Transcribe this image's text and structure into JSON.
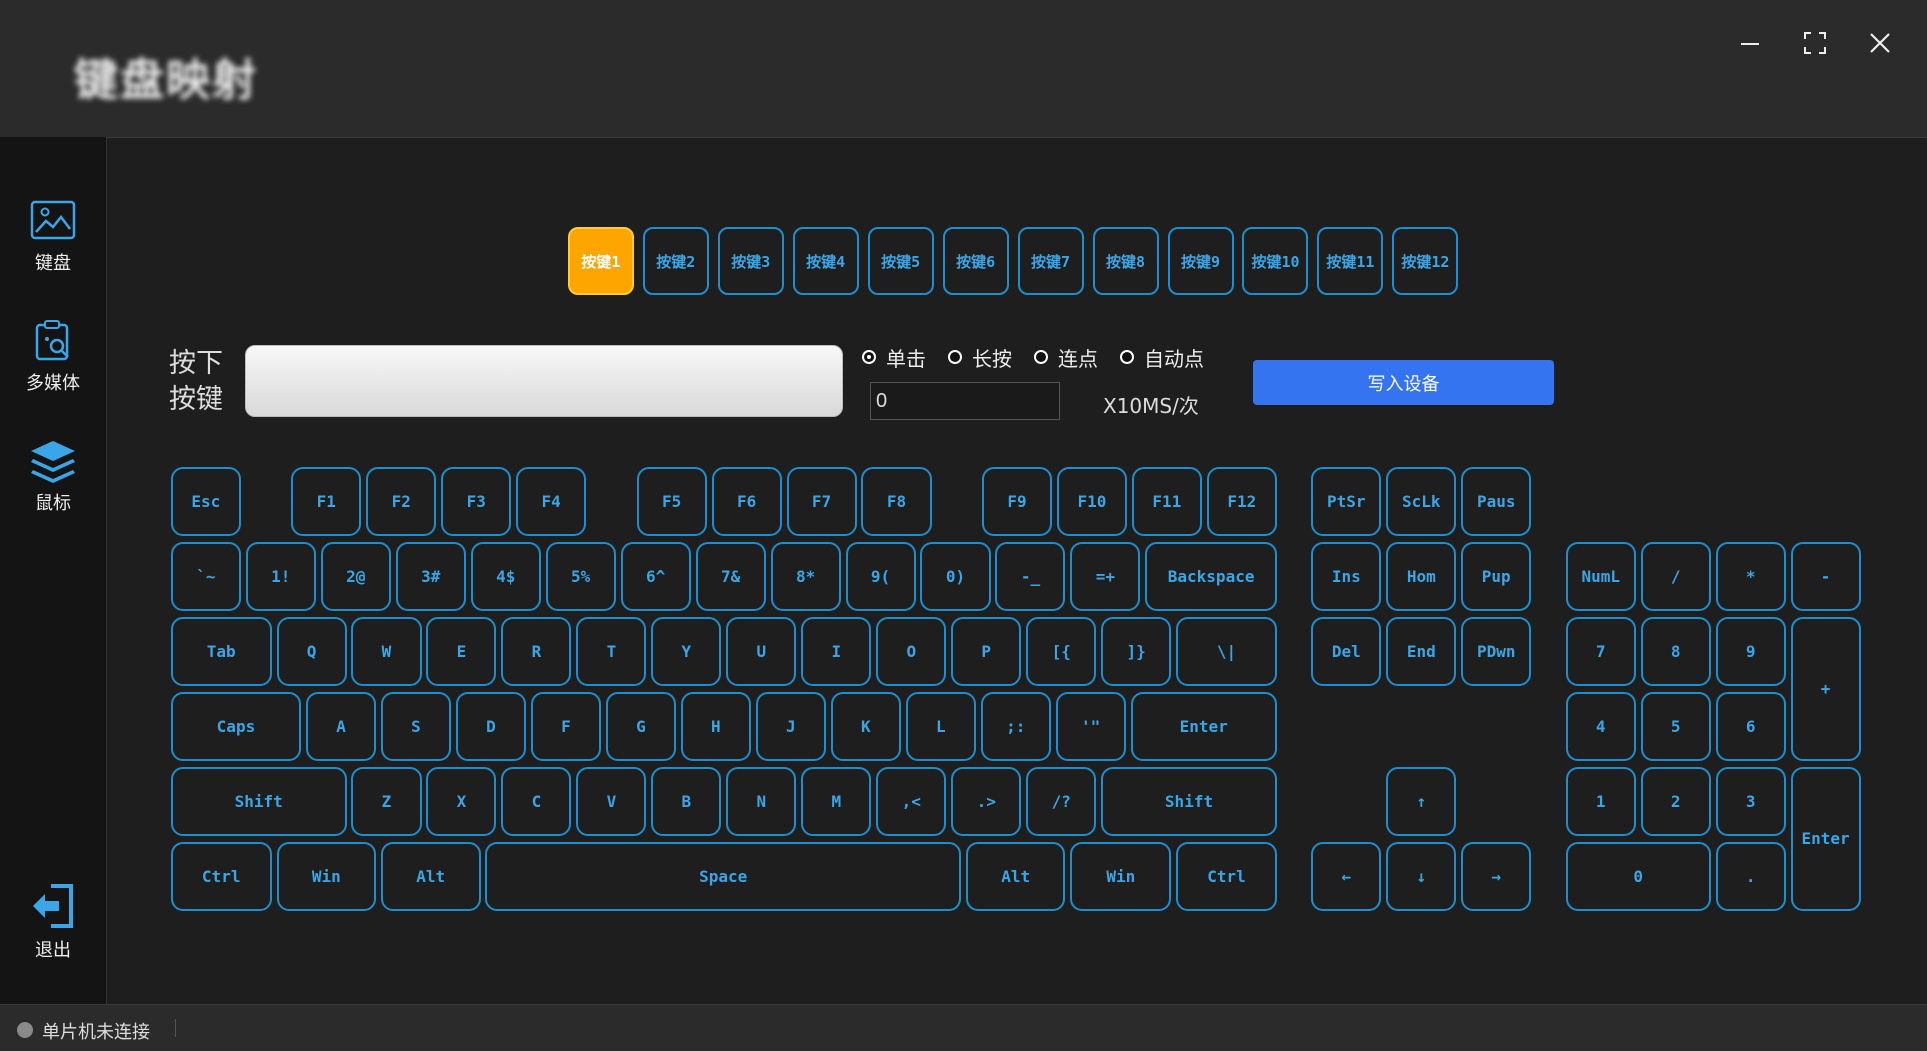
{
  "window": {
    "title": "键盘映射",
    "minimize_glyph": "—",
    "maximize_glyph": "⛶",
    "close_glyph": "✕"
  },
  "sidebar": {
    "items": [
      {
        "label": "键盘",
        "icon": "keyboard-image-icon"
      },
      {
        "label": "多媒体",
        "icon": "media-clipboard-icon"
      },
      {
        "label": "鼠标",
        "icon": "layers-icon"
      }
    ],
    "exit_label": "退出",
    "exit_icon": "exit-icon"
  },
  "slots": [
    "按键1",
    "按键2",
    "按键3",
    "按键4",
    "按键5",
    "按键6",
    "按键7",
    "按键8",
    "按键9",
    "按键10",
    "按键11",
    "按键12"
  ],
  "active_slot": 0,
  "press_label_line1": "按下",
  "press_label_line2": "按键",
  "modes": [
    {
      "label": "单击",
      "checked": true
    },
    {
      "label": "长按",
      "checked": false
    },
    {
      "label": "连点",
      "checked": false
    },
    {
      "label": "自动点",
      "checked": false
    }
  ],
  "interval": {
    "value": "0",
    "unit": "X10MS/次"
  },
  "write_button": "写入设备",
  "keys": {
    "func": [
      "Esc",
      "F1",
      "F2",
      "F3",
      "F4",
      "F5",
      "F6",
      "F7",
      "F8",
      "F9",
      "F10",
      "F11",
      "F12"
    ],
    "num": [
      "`~",
      "1!",
      "2@",
      "3#",
      "4$",
      "5%",
      "6^",
      "7&",
      "8*",
      "9(",
      "0)",
      "-_",
      "=+",
      "Backspace"
    ],
    "top": [
      "Tab",
      "Q",
      "W",
      "E",
      "R",
      "T",
      "Y",
      "U",
      "I",
      "O",
      "P",
      "[{",
      "]}",
      "\\|"
    ],
    "home": [
      "Caps",
      "A",
      "S",
      "D",
      "F",
      "G",
      "H",
      "J",
      "K",
      "L",
      ";:",
      "'\"",
      "Enter"
    ],
    "shift": [
      "Shift",
      "Z",
      "X",
      "C",
      "V",
      "B",
      "N",
      "M",
      ",<",
      ".>",
      "/?",
      "Shift"
    ],
    "bottom": [
      "Ctrl",
      "Win",
      "Alt",
      "Space",
      "Alt",
      "Win",
      "Ctrl"
    ],
    "nav": [
      "PtSr",
      "ScLk",
      "Paus",
      "Ins",
      "Hom",
      "Pup",
      "Del",
      "End",
      "PDwn"
    ],
    "arrows": [
      "↑",
      "←",
      "↓",
      "→"
    ],
    "numpad": [
      "NumL",
      "/",
      "*",
      "-",
      "7",
      "8",
      "9",
      "+",
      "4",
      "5",
      "6",
      "1",
      "2",
      "3",
      "Enter",
      "0",
      "."
    ]
  },
  "status": {
    "text": "单片机未连接",
    "dot_color": "#8a8a8a"
  }
}
